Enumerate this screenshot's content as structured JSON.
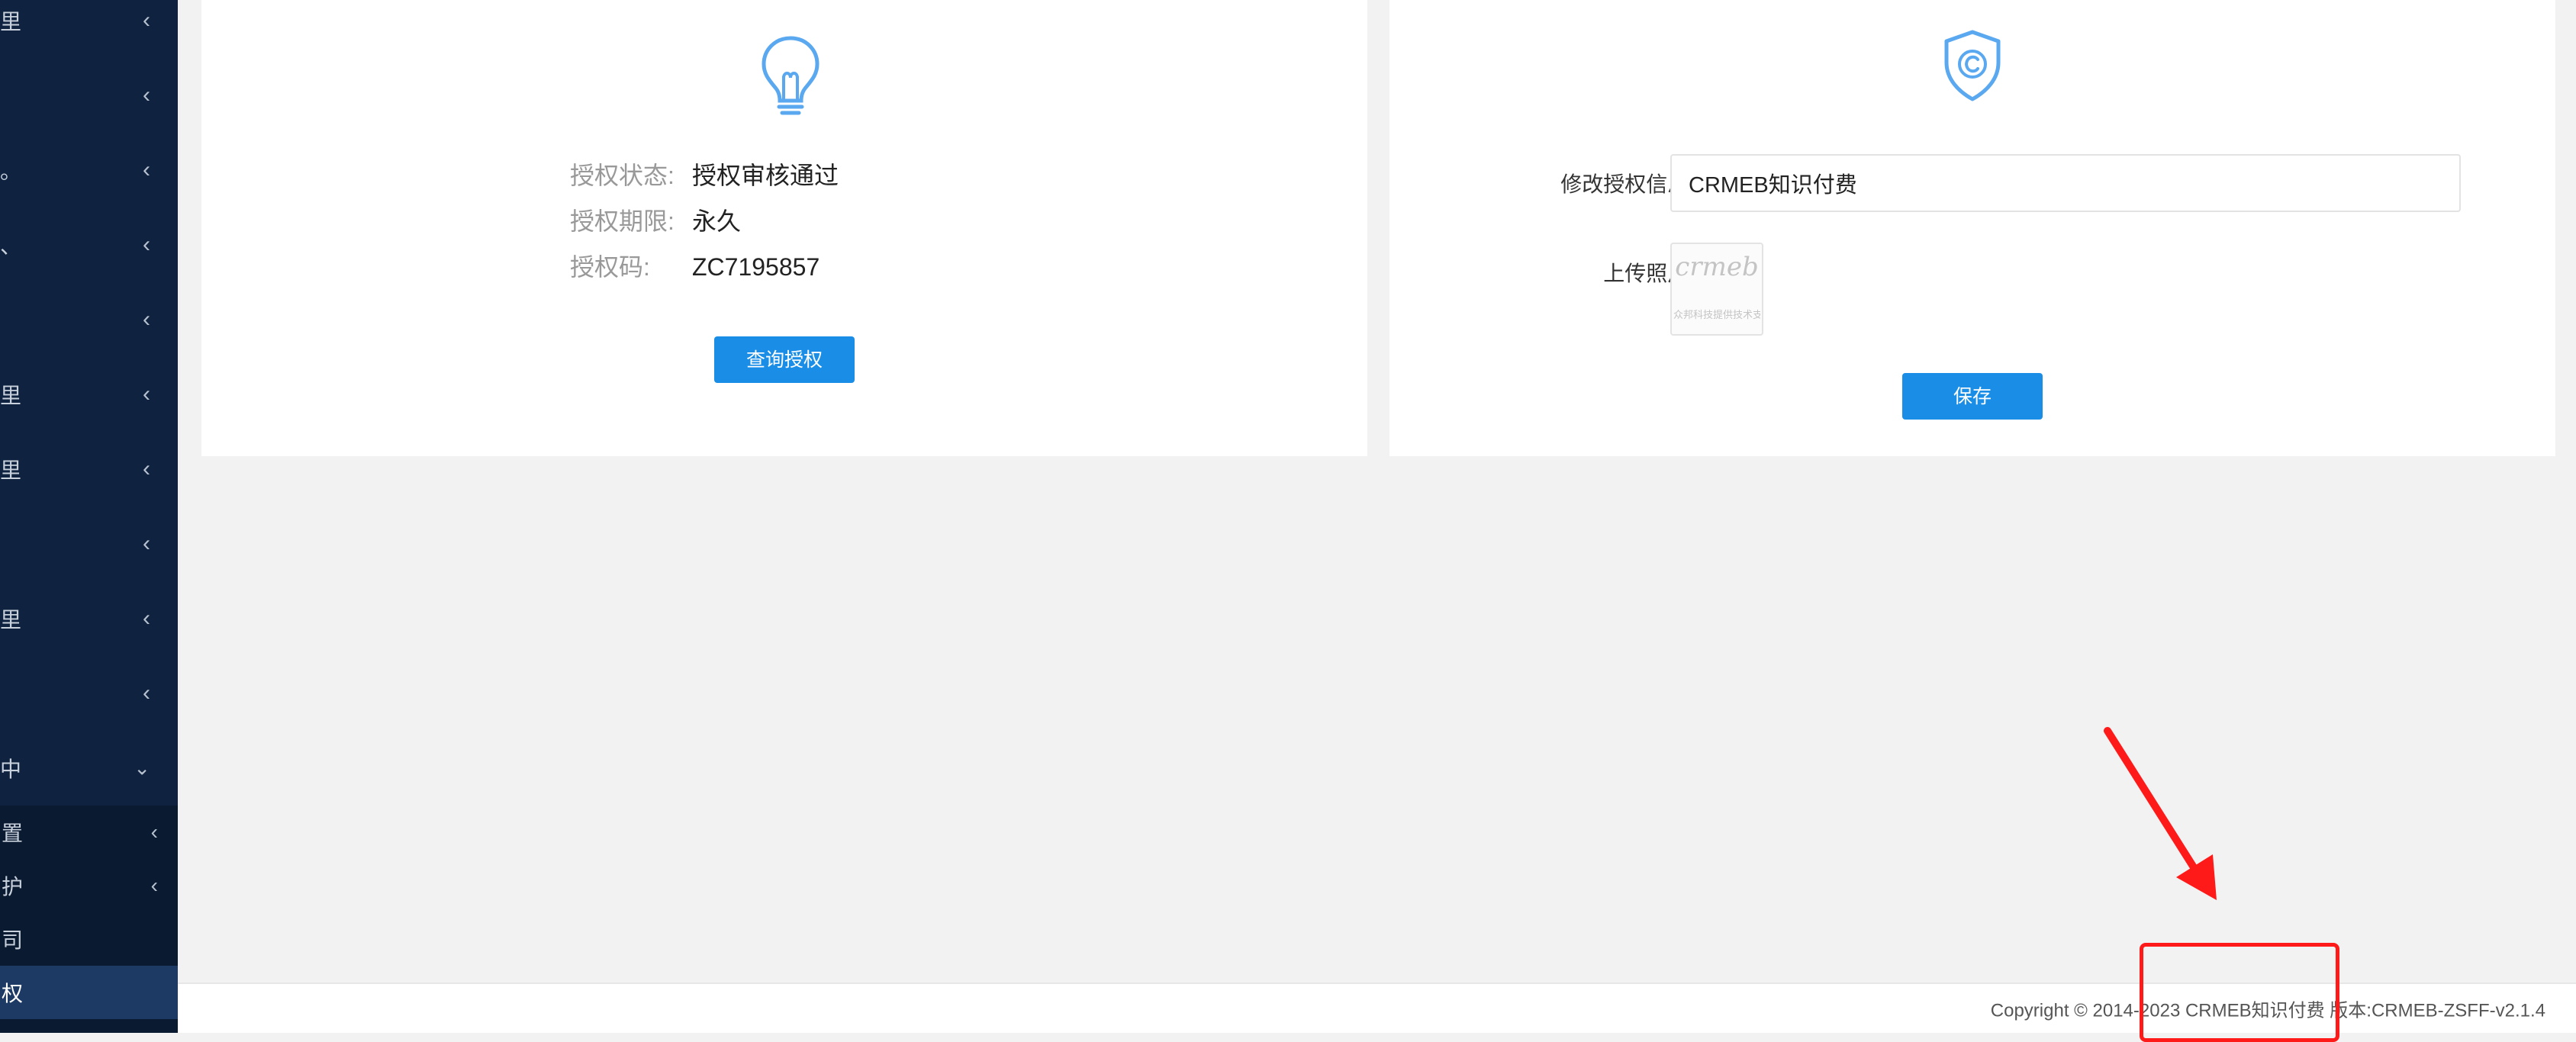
{
  "sidebar": {
    "items": [
      {
        "glyph": "里"
      },
      {
        "glyph": ""
      },
      {
        "glyph": "。"
      },
      {
        "glyph": "、"
      },
      {
        "glyph": ""
      },
      {
        "glyph": "里"
      },
      {
        "glyph": "里"
      },
      {
        "glyph": ""
      },
      {
        "glyph": "里"
      },
      {
        "glyph": ""
      }
    ],
    "group": {
      "glyph": "中"
    },
    "sub_items": [
      {
        "label": "置"
      },
      {
        "label": "护"
      },
      {
        "label": "司"
      },
      {
        "label": "权"
      }
    ]
  },
  "auth_card": {
    "status_label": "授权状态:",
    "status_value": "授权审核通过",
    "period_label": "授权期限:",
    "period_value": "永久",
    "code_label": "授权码:",
    "code_value": "ZC7195857",
    "query_button": "查询授权"
  },
  "edit_card": {
    "info_label": "修改授权信息:",
    "info_value": "CRMEB知识付费",
    "upload_label": "上传照片:",
    "thumb_logo": "crmeb",
    "thumb_caption": "众邦科技提供技术支持",
    "save_button": "保存"
  },
  "footer": {
    "copyright": "Copyright © 2014-2023 CRMEB知识付费 版本:CRMEB-ZSFF-v2.1.4"
  },
  "colors": {
    "sidebar_bg": "#0f2340",
    "primary": "#1a8ee6",
    "icon_blue": "#5aa8f0",
    "annotation_red": "#ff1a1a"
  }
}
